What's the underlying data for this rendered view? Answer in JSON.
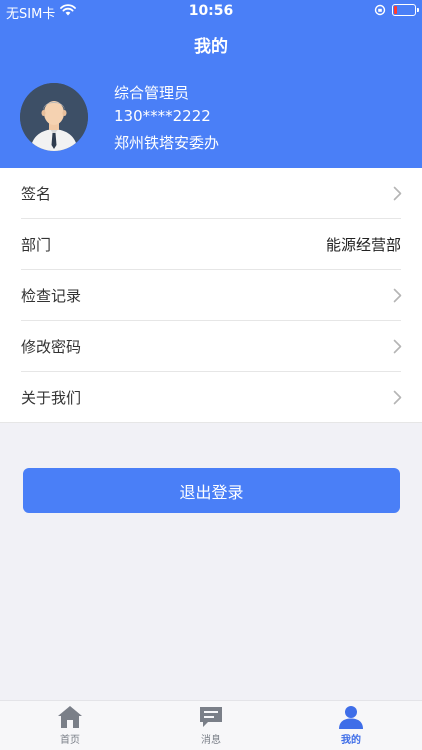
{
  "status_bar": {
    "carrier": "无SIM卡",
    "time": "10:56"
  },
  "header": {
    "title": "我的"
  },
  "profile": {
    "name": "综合管理员",
    "phone": "130****2222",
    "organization": "郑州铁塔安委办"
  },
  "menu": {
    "items": [
      {
        "label": "签名",
        "value": "",
        "icon": "chevron-right-icon"
      },
      {
        "label": "部门",
        "value": "能源经营部"
      },
      {
        "label": "检查记录",
        "value": "",
        "icon": "chevron-right-icon"
      },
      {
        "label": "修改密码",
        "value": "",
        "icon": "chevron-right-icon"
      },
      {
        "label": "关于我们",
        "value": "",
        "icon": "chevron-right-icon"
      }
    ]
  },
  "logout": {
    "label": "退出登录"
  },
  "tabbar": {
    "tabs": [
      {
        "label": "首页",
        "icon": "home-icon",
        "active": false
      },
      {
        "label": "消息",
        "icon": "message-icon",
        "active": false
      },
      {
        "label": "我的",
        "icon": "user-icon",
        "active": true
      }
    ]
  },
  "colors": {
    "primary": "#4a7ff7",
    "tab_active": "#3f6ee8",
    "tab_inactive": "#7a7f88",
    "background": "#f1f1f6"
  }
}
